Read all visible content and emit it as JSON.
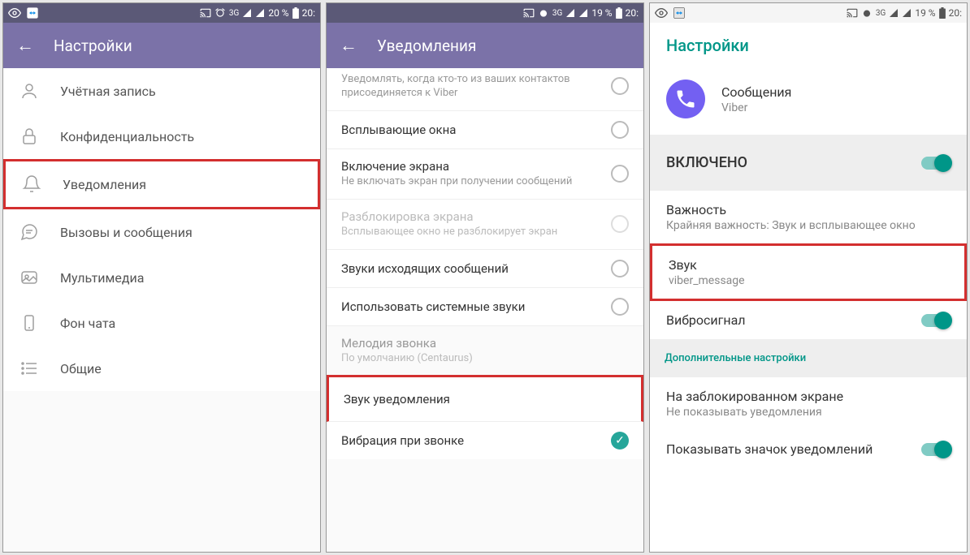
{
  "status": {
    "battery1": "20 %",
    "time1": "20:",
    "battery2": "19 %",
    "time2": "20:",
    "battery3": "19 %",
    "time3": "20:",
    "network": "3G"
  },
  "screen1": {
    "title": "Настройки",
    "items": [
      {
        "label": "Учётная запись"
      },
      {
        "label": "Конфиденциальность"
      },
      {
        "label": "Уведомления"
      },
      {
        "label": "Вызовы и сообщения"
      },
      {
        "label": "Мультимедиа"
      },
      {
        "label": "Фон чата"
      },
      {
        "label": "Общие"
      }
    ]
  },
  "screen2": {
    "title": "Уведомления",
    "partial_top": "Уведомлять, когда кто-то из ваших контактов присоединяется к Viber",
    "items": {
      "popup": {
        "title": "Всплывающие окна"
      },
      "screen_on": {
        "title": "Включение экрана",
        "sub": "Не включать экран при получении сообщений"
      },
      "unlock": {
        "title": "Разблокировка экрана",
        "sub": "Всплывающее окно не разблокирует экран"
      },
      "outgoing": {
        "title": "Звуки исходящих сообщений"
      },
      "system": {
        "title": "Использовать системные звуки"
      },
      "ringtone": {
        "title": "Мелодия звонка",
        "sub": "По умолчанию (Centaurus)"
      },
      "notif_sound": {
        "title": "Звук уведомления"
      },
      "vibrate": {
        "title": "Вибрация при звонке"
      }
    }
  },
  "screen3": {
    "title": "Настройки",
    "app_name": "Сообщения",
    "app_sub": "Viber",
    "enabled": "ВКЛЮЧЕНО",
    "importance": {
      "title": "Важность",
      "sub": "Крайняя важность: Звук и всплывающее окно"
    },
    "sound": {
      "title": "Звук",
      "sub": "viber_message"
    },
    "vibro": {
      "title": "Вибросигнал"
    },
    "additional": "Дополнительные настройки",
    "lockscreen": {
      "title": "На заблокированном экране",
      "sub": "Не показывать уведомления"
    },
    "badge": {
      "title": "Показывать значок уведомлений"
    }
  }
}
